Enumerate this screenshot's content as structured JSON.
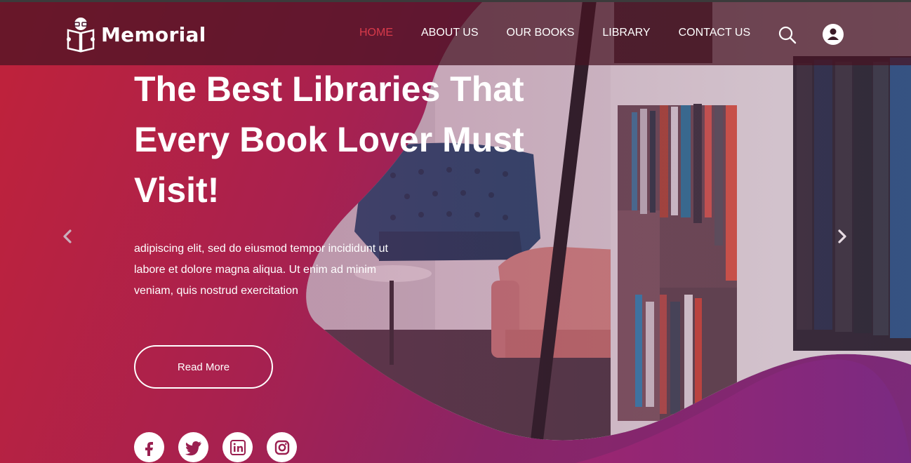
{
  "brand": {
    "name": "Memorial"
  },
  "nav": {
    "items": [
      {
        "label": "HOME",
        "active": true
      },
      {
        "label": "ABOUT US",
        "active": false
      },
      {
        "label": "OUR BOOKS",
        "active": false
      },
      {
        "label": "LIBRARY",
        "active": false
      },
      {
        "label": "CONTACT US",
        "active": false
      }
    ],
    "active_color": "#d83a4a"
  },
  "hero": {
    "headline_lines": [
      "The Best Libraries That",
      "Every Book Lover Must",
      "Visit!"
    ],
    "paragraph_lines": [
      "adipiscing elit, sed do eiusmod tempor incididunt ut",
      "labore et dolore magna aliqua. Ut enim ad minim",
      "veniam, quis nostrud exercitation"
    ],
    "button_label": "Read More"
  },
  "icons": {
    "search": "search-icon",
    "user": "user-icon",
    "prev": "chevron-left-icon",
    "next": "chevron-right-icon",
    "socials": [
      "facebook-icon",
      "twitter-icon",
      "linkedin-icon",
      "instagram-icon"
    ]
  },
  "colors": {
    "gradient_start": "#c0223a",
    "gradient_end": "#7a2a7a",
    "nav_bg": "#46142380"
  }
}
